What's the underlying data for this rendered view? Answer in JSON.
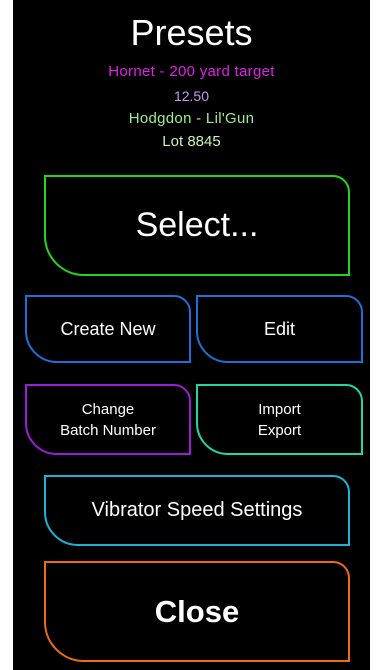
{
  "header": {
    "title": "Presets",
    "preset_name": "Hornet - 200 yard target",
    "charge_weight": "12.50",
    "powder": "Hodgdon - Lil'Gun",
    "lot": "Lot 8845"
  },
  "buttons": {
    "select": "Select...",
    "create_new": "Create New",
    "edit": "Edit",
    "change_batch_line1": "Change",
    "change_batch_line2": "Batch Number",
    "import_line1": "Import",
    "import_line2": "Export",
    "vibrator": "Vibrator Speed Settings",
    "close": "Close"
  },
  "colors": {
    "preset_name": "#e11ee6",
    "charge_weight": "#c79af2",
    "powder": "#9df08c",
    "lot": "#c8f2b9",
    "select_border": "#22d61d",
    "create_border": "#1f6fd8",
    "edit_border": "#1f6fd8",
    "batch_border": "#9a1ed6",
    "import_border": "#23d6a2",
    "vibrator_border": "#1ab4d6",
    "close_border": "#f06a12"
  }
}
